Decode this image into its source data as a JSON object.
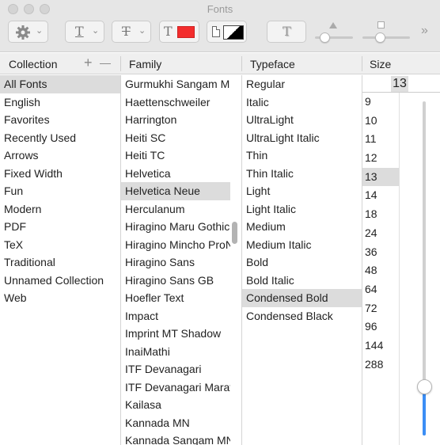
{
  "window": {
    "title": "Fonts"
  },
  "toolbar": {
    "action_icon": "gear-icon",
    "underline_glyph": "T",
    "strikethrough_glyph": "T",
    "text_color_glyph": "T",
    "text_color": "#f32d2d",
    "document_color_icon": "document-icon",
    "shadow_glyph": "T",
    "more_glyph": "»"
  },
  "columns": {
    "collection_label": "Collection",
    "add_symbol": "+",
    "remove_symbol": "—",
    "family_label": "Family",
    "typeface_label": "Typeface",
    "size_label": "Size"
  },
  "collections": {
    "selected": "All Fonts",
    "items": [
      "All Fonts",
      "English",
      "Favorites",
      "Recently Used",
      "Arrows",
      "Fixed Width",
      "Fun",
      "Modern",
      "PDF",
      "TeX",
      "Traditional",
      "Unnamed Collection",
      "Web"
    ]
  },
  "families": {
    "selected": "Helvetica Neue",
    "items": [
      "Gurmukhi Sangam MN",
      "Haettenschweiler",
      "Harrington",
      "Heiti SC",
      "Heiti TC",
      "Helvetica",
      "Helvetica Neue",
      "Herculanum",
      "Hiragino Maru Gothic ProN",
      "Hiragino Mincho ProN",
      "Hiragino Sans",
      "Hiragino Sans GB",
      "Hoefler Text",
      "Impact",
      "Imprint MT Shadow",
      "InaiMathi",
      "ITF Devanagari",
      "ITF Devanagari Marathi",
      "Kailasa",
      "Kannada MN",
      "Kannada Sangam MN"
    ]
  },
  "typefaces": {
    "selected": "Condensed Bold",
    "items": [
      "Regular",
      "Italic",
      "UltraLight",
      "UltraLight Italic",
      "Thin",
      "Thin Italic",
      "Light",
      "Light Italic",
      "Medium",
      "Medium Italic",
      "Bold",
      "Bold Italic",
      "Condensed Bold",
      "Condensed Black"
    ]
  },
  "size": {
    "current": "13",
    "items": [
      "9",
      "10",
      "11",
      "12",
      "13",
      "14",
      "18",
      "24",
      "36",
      "48",
      "64",
      "72",
      "96",
      "144",
      "288"
    ],
    "selected": "13",
    "slider_fraction": 0.14,
    "accent_color": "#3b8ef5"
  }
}
